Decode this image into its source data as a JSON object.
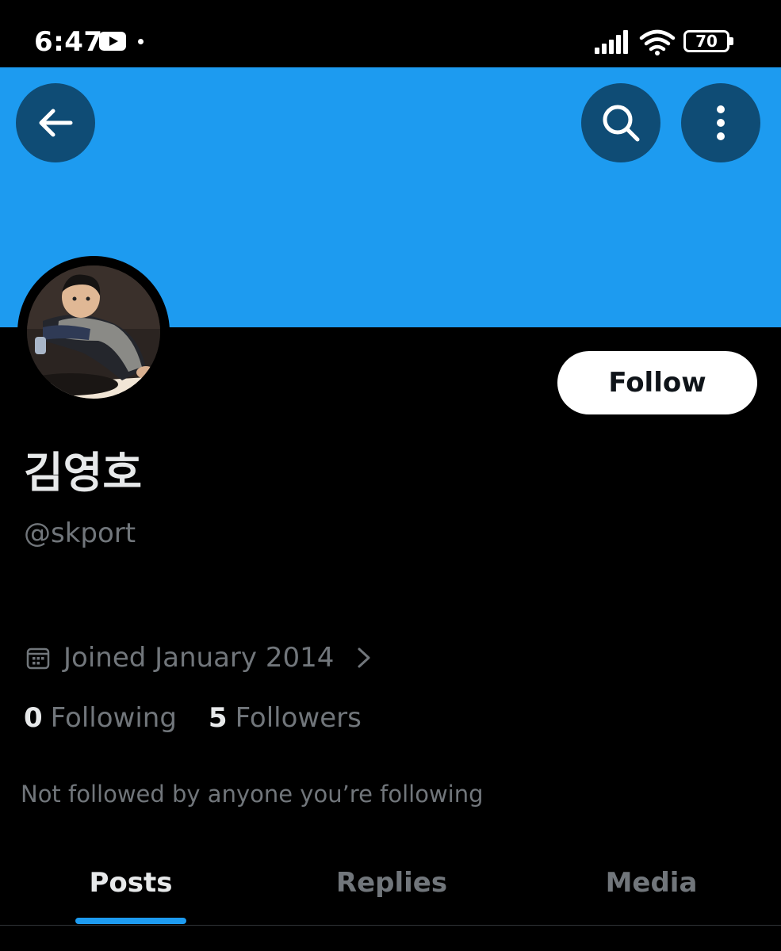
{
  "status_bar": {
    "time": "6:47",
    "battery": "70",
    "icons": [
      "youtube-icon",
      "notification-dot",
      "signal-icon",
      "wifi-icon",
      "battery-icon"
    ]
  },
  "header": {
    "banner_color": "#1d9bf0",
    "button_color": "#0f4c75",
    "icons": [
      "arrow-left-icon",
      "search-icon",
      "more-vertical-icon"
    ]
  },
  "profile": {
    "display_name": "김영호",
    "handle": "@skport",
    "follow_label": "Follow",
    "joined": "Joined January 2014",
    "following_count": "0",
    "following_label": "Following",
    "followers_count": "5",
    "followers_label": "Followers",
    "mutual_note": "Not followed by anyone you’re following"
  },
  "tabs": [
    {
      "label": "Posts",
      "active": true
    },
    {
      "label": "Replies",
      "active": false
    },
    {
      "label": "Media",
      "active": false
    }
  ],
  "colors": {
    "accent": "#1d9bf0",
    "background": "#000000",
    "primary_text": "#e7e9ea",
    "secondary_text": "#71767b"
  }
}
